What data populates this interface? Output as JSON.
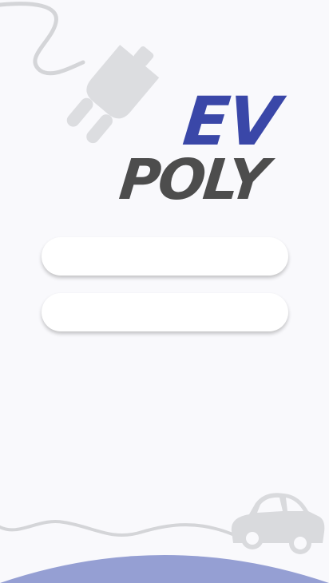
{
  "app": {
    "logo_line1": "EV",
    "logo_line2": "POLY",
    "brand_color": "#3a47a8",
    "logo_dark_color": "#4d4d4d",
    "ground_color": "#959fd3"
  },
  "login": {
    "username_value": "",
    "username_placeholder": "",
    "password_value": "",
    "password_placeholder": ""
  },
  "icons": {
    "plug": "charging-plug-icon",
    "car": "car-icon"
  }
}
